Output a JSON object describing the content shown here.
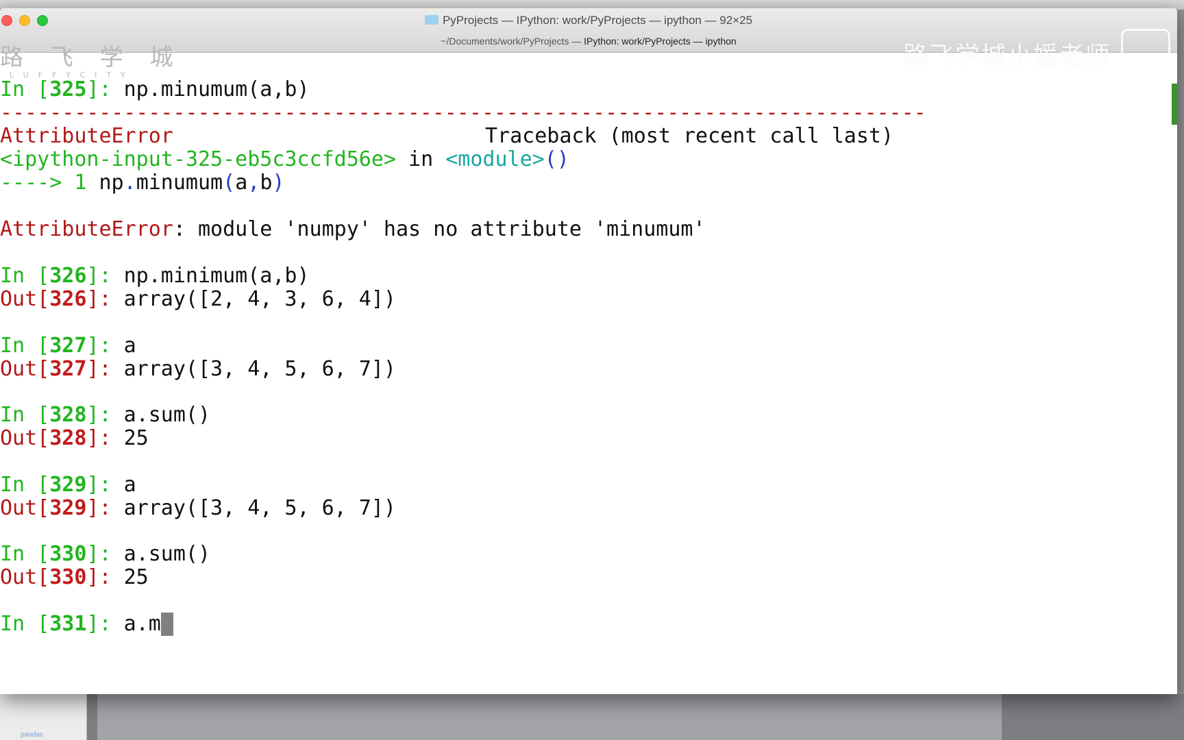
{
  "window": {
    "title": "PyProjects — IPython: work/PyProjects — ipython — 92×25",
    "tab_path_prefix": "~/Documents/work/PyProjects — ",
    "tab_path_current": "IPython: work/PyProjects — ipython"
  },
  "watermark": {
    "left_cn": "路 飞 学 城",
    "left_en": "LUFFYCITY",
    "right": "路飞学城小媛老师"
  },
  "desktop": {
    "panel_text": "pandas"
  },
  "terminal": {
    "in_label": "In ",
    "out_label": "Out",
    "colon": ": ",
    "cells": [
      {
        "n": "325",
        "input": "np.minumum(a,b)"
      },
      {
        "n": "326",
        "input": "np.minimum(a,b)",
        "output": "array([2, 4, 3, 6, 4])"
      },
      {
        "n": "327",
        "input": "a",
        "output": "array([3, 4, 5, 6, 7])"
      },
      {
        "n": "328",
        "input": "a.sum()",
        "output": "25"
      },
      {
        "n": "329",
        "input": "a",
        "output": "array([3, 4, 5, 6, 7])"
      },
      {
        "n": "330",
        "input": "a.sum()",
        "output": "25"
      },
      {
        "n": "331",
        "input": "a.m"
      }
    ],
    "traceback": {
      "dashes": "---------------------------------------------------------------------------",
      "error_name": "AttributeError",
      "header_right": "Traceback (most recent call last)",
      "source": "<ipython-input-325-eb5c3ccfd56e>",
      "in_word": " in ",
      "module": "<module>",
      "parens": "()",
      "arrow": "----> 1 ",
      "code_np": "np",
      "code_dot": ".",
      "code_attr": "minumum",
      "code_open": "(",
      "code_a": "a",
      "code_comma": ",",
      "code_b": "b",
      "code_close": ")",
      "message": ": module 'numpy' has no attribute 'minumum'"
    }
  }
}
